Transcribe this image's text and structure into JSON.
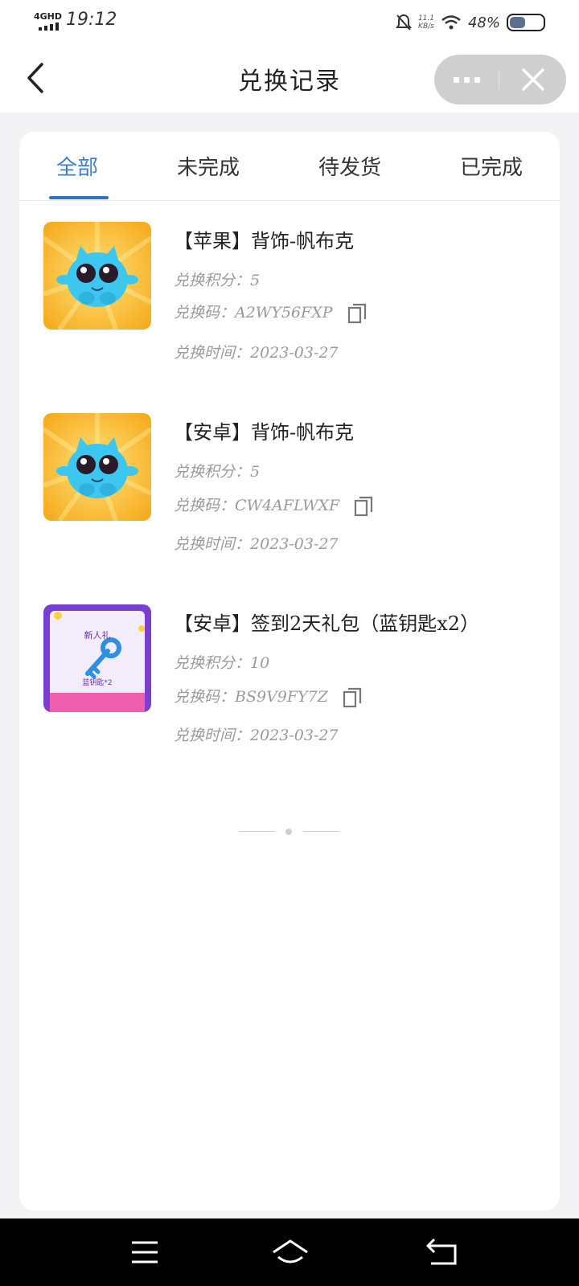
{
  "status_bar": {
    "network": "4GHD",
    "time": "19:12",
    "speed": "11.1",
    "speed_unit": "KB/s",
    "battery_percent": "48%",
    "battery_level": 0.48
  },
  "nav": {
    "title": "兑换记录",
    "back_icon": "chevron-left-icon",
    "more_icon": "more-dots-icon",
    "close_icon": "close-icon"
  },
  "tabs": [
    {
      "label": "全部",
      "active": true
    },
    {
      "label": "未完成",
      "active": false
    },
    {
      "label": "待发货",
      "active": false
    },
    {
      "label": "已完成",
      "active": false
    }
  ],
  "records": [
    {
      "title": "【苹果】背饰-帆布克",
      "points": "兑换积分：5",
      "code": "兑换码：A2WY56FXP",
      "time": "兑换时间：2023-03-27",
      "image": "blue-creature-image"
    },
    {
      "title": "【安卓】背饰-帆布克",
      "points": "兑换积分：5",
      "code": "兑换码：CW4AFLWXF",
      "time": "兑换时间：2023-03-27",
      "image": "blue-creature-image"
    },
    {
      "title": "【安卓】签到2天礼包（蓝钥匙x2）",
      "points": "兑换积分：10",
      "code": "兑换码：BS9V9FY7Z",
      "time": "兑换时间：2023-03-27",
      "image": "blue-key-gift-image",
      "image_text_top": "新人礼",
      "image_text_bottom": "蓝钥匙*2"
    }
  ],
  "colors": {
    "accent": "#2f72cc",
    "page_bg": "#f3f3f6",
    "capsule_bg": "#cfcfcf"
  },
  "system_nav": {
    "menu_icon": "menu-icon",
    "home_icon": "home-icon",
    "back_icon": "back-arrow-icon"
  }
}
